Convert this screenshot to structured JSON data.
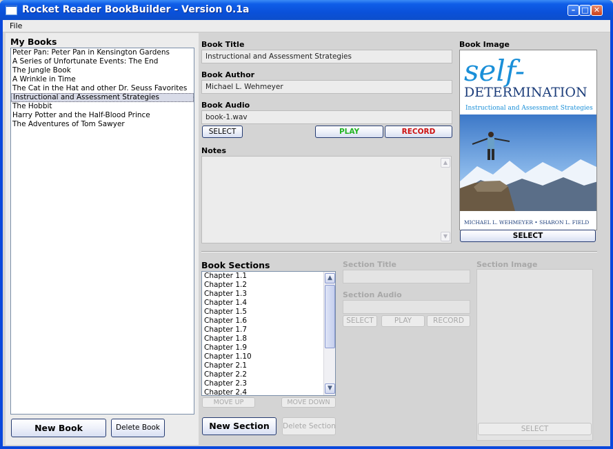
{
  "window": {
    "title": "Rocket Reader BookBuilder - Version 0.1a"
  },
  "menu": {
    "file": "File"
  },
  "left": {
    "heading": "My Books",
    "books": [
      "Peter Pan:  Peter Pan in Kensington Gardens",
      "A Series of Unfortunate Events: The End",
      "The Jungle Book",
      "A Wrinkle in Time",
      "The Cat in the Hat and other Dr. Seuss Favorites",
      "Instructional and Assessment Strategies",
      "The Hobbit",
      "Harry Potter and the Half-Blood Prince",
      "The Adventures of Tom Sawyer"
    ],
    "selected_index": 5,
    "new_book": "New Book",
    "delete_book": "Delete Book"
  },
  "book": {
    "title_label": "Book Title",
    "title_value": "Instructional and Assessment Strategies",
    "author_label": "Book Author",
    "author_value": "Michael L. Wehmeyer",
    "audio_label": "Book Audio",
    "audio_value": "book-1.wav",
    "select": "SELECT",
    "play": "PLAY",
    "record": "RECORD",
    "notes_label": "Notes",
    "image_label": "Book Image",
    "image_select": "SELECT"
  },
  "cover": {
    "line1": "self-",
    "line2": "DETERMINATION",
    "subtitle": "Instructional and Assessment Strategies",
    "authors": "MICHAEL L. WEHMEYER • SHARON L. FIELD"
  },
  "sections": {
    "heading": "Book Sections",
    "items": [
      "Chapter 1.1",
      "Chapter 1.2",
      "Chapter 1.3",
      "Chapter 1.4",
      "Chapter 1.5",
      "Chapter 1.6",
      "Chapter 1.7",
      "Chapter 1.8",
      "Chapter 1.9",
      "Chapter 1.10",
      "Chapter 2.1",
      "Chapter 2.2",
      "Chapter 2.3",
      "Chapter 2.4"
    ],
    "move_up": "MOVE UP",
    "move_down": "MOVE DOWN",
    "new_section": "New Section",
    "delete_section": "Delete Section",
    "title_label": "Section Title",
    "audio_label": "Section Audio",
    "select": "SELECT",
    "play": "PLAY",
    "record": "RECORD",
    "image_label": "Section Image",
    "image_select": "SELECT"
  },
  "colors": {
    "play": "#22b422",
    "record": "#cc1010",
    "titlebar": "#0a51da",
    "cover_blue": "#1a8fd8"
  }
}
